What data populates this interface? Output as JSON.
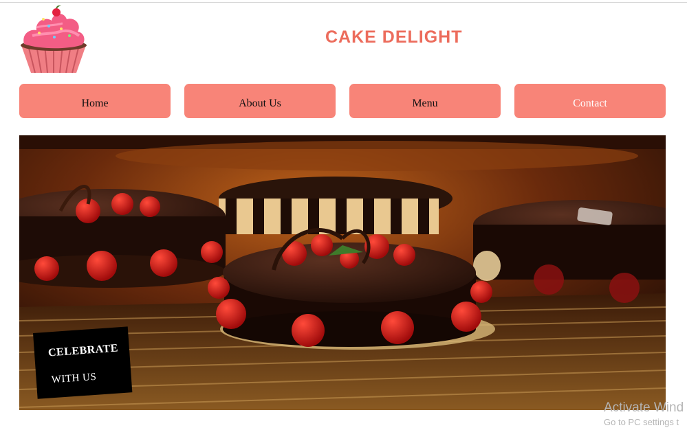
{
  "header": {
    "brand_title": "CAKE DELIGHT",
    "logo_icon": "cupcake-icon"
  },
  "nav": {
    "items": [
      {
        "label": "Home"
      },
      {
        "label": "About Us"
      },
      {
        "label": "Menu"
      },
      {
        "label": "Contact"
      }
    ],
    "active_item": "Contact",
    "button_color": "#f88478",
    "brand_color": "#ec6c5c"
  },
  "hero": {
    "image_subject": "chocolate cakes with strawberries on a display rack",
    "banner_line1": "CELEBRATE",
    "banner_line2": "WITH US"
  },
  "system_overlay": {
    "line1": "Activate Wind",
    "line2": "Go to PC settings t"
  }
}
